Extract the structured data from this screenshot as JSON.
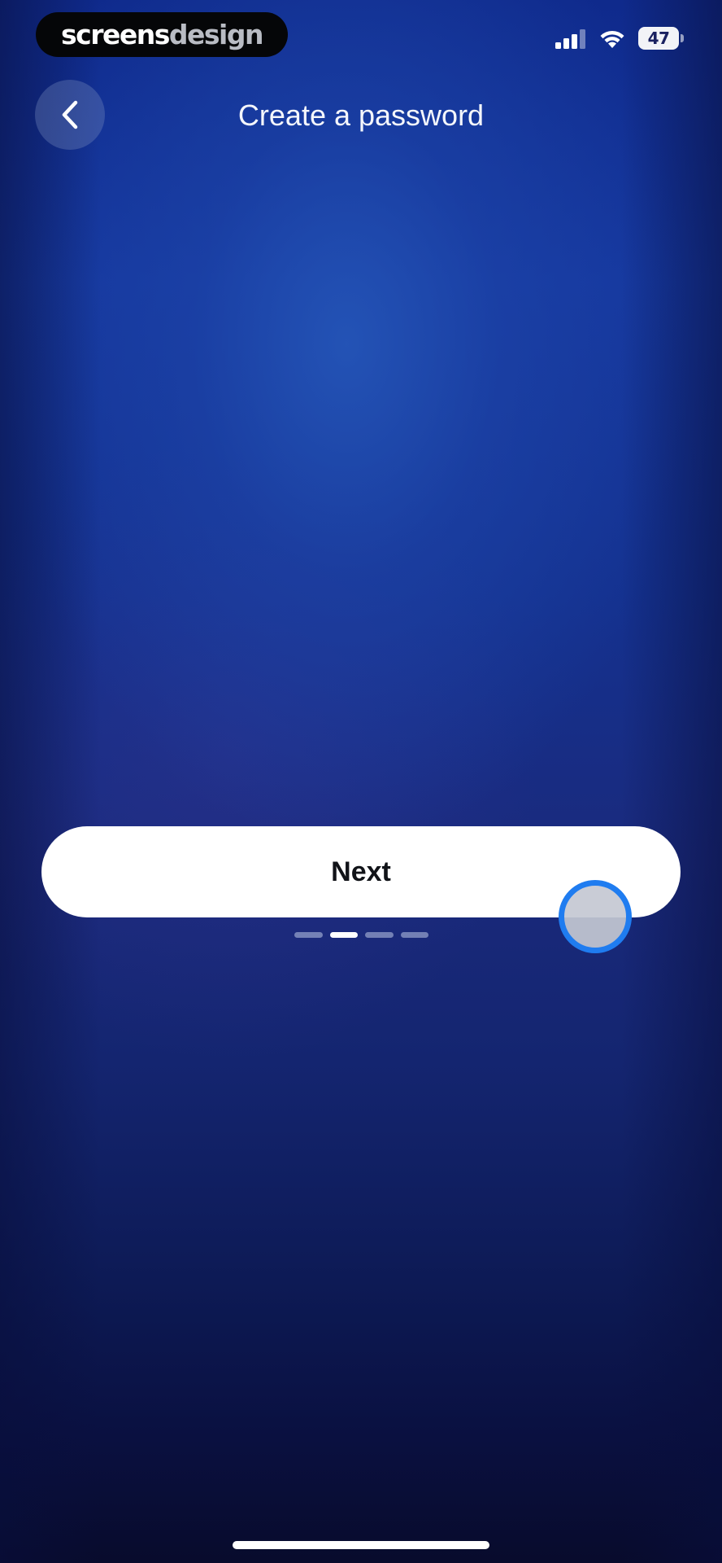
{
  "status_bar": {
    "brand_part1": "screens",
    "brand_part2": "design",
    "battery_level": "47",
    "icons": [
      "signal-icon",
      "wifi-icon",
      "battery-icon"
    ]
  },
  "header": {
    "back_icon": "chevron-left-icon",
    "title": "Create a password"
  },
  "actions": {
    "next_label": "Next"
  },
  "pager": {
    "total": 4,
    "active_index": 1
  },
  "colors": {
    "background_top": "#0f2a8c",
    "background_bottom": "#080b2c",
    "button_bg": "#ffffff",
    "button_text": "#111318",
    "touch_ring": "#1f7cf0"
  }
}
